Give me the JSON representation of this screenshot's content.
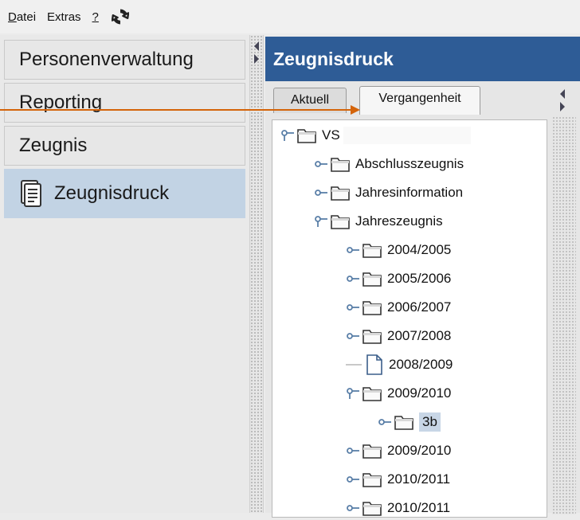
{
  "menu": {
    "items": [
      {
        "label": "Datei",
        "mnemonic_first": "D"
      },
      {
        "label": "Extras"
      },
      {
        "label": "?"
      }
    ]
  },
  "nav": {
    "items": [
      {
        "label": "Personenverwaltung"
      },
      {
        "label": "Reporting"
      },
      {
        "label": "Zeugnis"
      },
      {
        "label": "Zeugnisdruck",
        "active": true
      }
    ]
  },
  "panel": {
    "title": "Zeugnisdruck",
    "tabs": [
      {
        "label": "Aktuell"
      },
      {
        "label": "Vergangenheit",
        "selected": true
      }
    ]
  },
  "tree": {
    "root": "VS",
    "nodes": [
      {
        "label": "Abschlusszeugnis",
        "level": 1,
        "type": "folder",
        "expanded": false
      },
      {
        "label": "Jahresinformation",
        "level": 1,
        "type": "folder",
        "expanded": false
      },
      {
        "label": "Jahreszeugnis",
        "level": 1,
        "type": "folder",
        "expanded": true
      },
      {
        "label": "2004/2005",
        "level": 2,
        "type": "folder",
        "expanded": false
      },
      {
        "label": "2005/2006",
        "level": 2,
        "type": "folder",
        "expanded": false
      },
      {
        "label": "2006/2007",
        "level": 2,
        "type": "folder",
        "expanded": false
      },
      {
        "label": "2007/2008",
        "level": 2,
        "type": "folder",
        "expanded": false
      },
      {
        "label": "2008/2009",
        "level": 2,
        "type": "file"
      },
      {
        "label": "2009/2010",
        "level": 2,
        "type": "folder",
        "expanded": true
      },
      {
        "label": "3b",
        "level": 3,
        "type": "folder",
        "expanded": false,
        "highlighted": true
      },
      {
        "label": "2009/2010",
        "level": 2,
        "type": "folder",
        "expanded": false
      },
      {
        "label": "2010/2011",
        "level": 2,
        "type": "folder",
        "expanded": false
      },
      {
        "label": "2010/2011",
        "level": 2,
        "type": "folder",
        "expanded": false
      }
    ]
  },
  "colors": {
    "header": "#2e5c96",
    "active_nav": "#c2d3e4",
    "annotation_arrow": "#d4640a",
    "tree_handle": "#5a7fa8"
  }
}
